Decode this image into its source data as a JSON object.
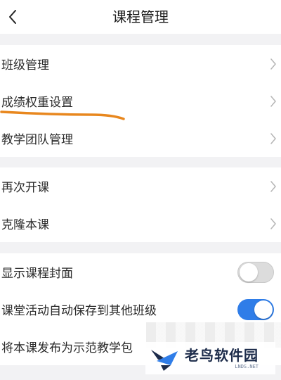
{
  "header": {
    "title": "课程管理",
    "back_icon": "chevron-left-icon"
  },
  "groups": [
    {
      "items": [
        {
          "label": "班级管理",
          "type": "link"
        },
        {
          "label": "成绩权重设置",
          "type": "link",
          "highlighted_with_underline": true
        },
        {
          "label": "教学团队管理",
          "type": "link"
        }
      ]
    },
    {
      "items": [
        {
          "label": "再次开课",
          "type": "link"
        },
        {
          "label": "克隆本课",
          "type": "link"
        }
      ]
    },
    {
      "items": [
        {
          "label": "显示课程封面",
          "type": "toggle",
          "on": false
        },
        {
          "label": "课堂活动自动保存到其他班级",
          "type": "toggle",
          "on": true
        },
        {
          "label": "将本课发布为示范教学包",
          "type": "truncated"
        }
      ]
    }
  ],
  "watermark": {
    "name": "老鸟软件园",
    "url": "LNDS.NET"
  },
  "colors": {
    "background": "#f2f2f4",
    "card": "#ffffff",
    "toggle_on": "#2f7de8",
    "toggle_off": "#dcdcdc",
    "underline": "#e8871e",
    "chevron": "#b5b5b5"
  }
}
